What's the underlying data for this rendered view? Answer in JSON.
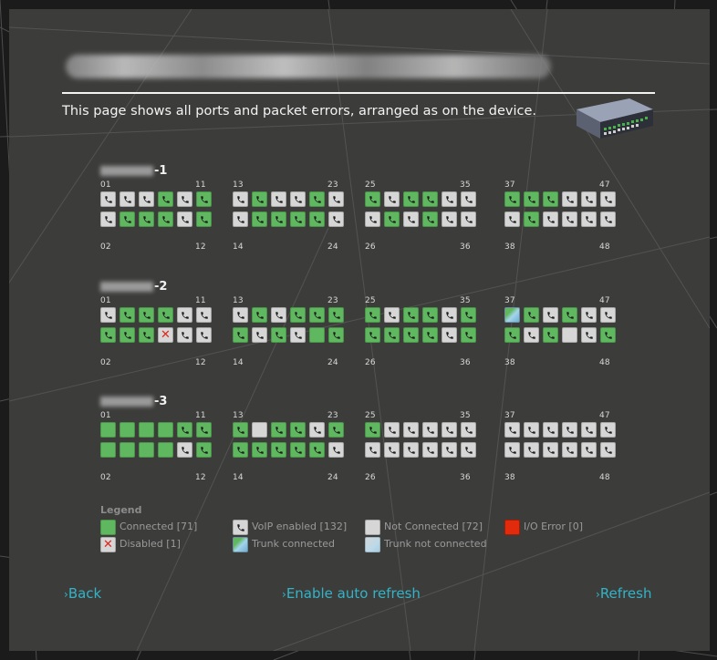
{
  "page": {
    "intro": "This page shows all ports and packet errors, arranged as on the device."
  },
  "colors": {
    "panel_background": "#3c3c3b",
    "connected": "#5fb85f",
    "not_connected": "#d6d6d6",
    "io_error": "#e12b0c",
    "link": "#34b3c7"
  },
  "device_icon": "network-switch-image",
  "units": [
    {
      "title_suffix": "-1",
      "groups": [
        {
          "top_first": "01",
          "top_last": "11",
          "bottom_first": "02",
          "bottom_last": "12",
          "top": [
            "N",
            "N",
            "N",
            "C",
            "N",
            "C"
          ],
          "bottom": [
            "N",
            "C",
            "C",
            "C",
            "N",
            "C"
          ]
        },
        {
          "top_first": "13",
          "top_last": "23",
          "bottom_first": "14",
          "bottom_last": "24",
          "top": [
            "N",
            "C",
            "N",
            "N",
            "C",
            "N"
          ],
          "bottom": [
            "N",
            "C",
            "C",
            "C",
            "C",
            "N"
          ]
        },
        {
          "top_first": "25",
          "top_last": "35",
          "bottom_first": "26",
          "bottom_last": "36",
          "top": [
            "C",
            "N",
            "C",
            "C",
            "N",
            "N"
          ],
          "bottom": [
            "N",
            "C",
            "N",
            "C",
            "N",
            "N"
          ]
        },
        {
          "top_first": "37",
          "top_last": "47",
          "bottom_first": "38",
          "bottom_last": "48",
          "top": [
            "C",
            "C",
            "C",
            "N",
            "N",
            "N"
          ],
          "bottom": [
            "N",
            "C",
            "N",
            "N",
            "N",
            "N"
          ]
        }
      ]
    },
    {
      "title_suffix": "-2",
      "groups": [
        {
          "top_first": "01",
          "top_last": "11",
          "bottom_first": "02",
          "bottom_last": "12",
          "top": [
            "N",
            "C",
            "C",
            "C",
            "N",
            "N"
          ],
          "bottom": [
            "C",
            "C",
            "C",
            "D",
            "N",
            "N"
          ]
        },
        {
          "top_first": "13",
          "top_last": "23",
          "bottom_first": "14",
          "bottom_last": "24",
          "top": [
            "N",
            "C",
            "N",
            "C",
            "C",
            "C"
          ],
          "bottom": [
            "C",
            "N",
            "C",
            "N",
            "G",
            "C"
          ]
        },
        {
          "top_first": "25",
          "top_last": "35",
          "bottom_first": "26",
          "bottom_last": "36",
          "top": [
            "C",
            "N",
            "C",
            "C",
            "N",
            "C"
          ],
          "bottom": [
            "C",
            "C",
            "C",
            "C",
            "N",
            "C"
          ]
        },
        {
          "top_first": "37",
          "top_last": "47",
          "bottom_first": "38",
          "bottom_last": "48",
          "top": [
            "T",
            "C",
            "N",
            "C",
            "N",
            "N"
          ],
          "bottom": [
            "C",
            "N",
            "C",
            "X",
            "N",
            "C"
          ]
        }
      ]
    },
    {
      "title_suffix": "-3",
      "groups": [
        {
          "top_first": "01",
          "top_last": "11",
          "bottom_first": "02",
          "bottom_last": "12",
          "top": [
            "G",
            "G",
            "G",
            "G",
            "C",
            "C"
          ],
          "bottom": [
            "G",
            "G",
            "G",
            "G",
            "N",
            "C"
          ]
        },
        {
          "top_first": "13",
          "top_last": "23",
          "bottom_first": "14",
          "bottom_last": "24",
          "top": [
            "C",
            "X",
            "C",
            "C",
            "N",
            "C"
          ],
          "bottom": [
            "C",
            "C",
            "C",
            "C",
            "C",
            "N"
          ]
        },
        {
          "top_first": "25",
          "top_last": "35",
          "bottom_first": "26",
          "bottom_last": "36",
          "top": [
            "C",
            "N",
            "N",
            "N",
            "N",
            "N"
          ],
          "bottom": [
            "N",
            "N",
            "N",
            "N",
            "N",
            "N"
          ]
        },
        {
          "top_first": "37",
          "top_last": "47",
          "bottom_first": "38",
          "bottom_last": "48",
          "top": [
            "N",
            "N",
            "N",
            "N",
            "N",
            "N"
          ],
          "bottom": [
            "N",
            "N",
            "N",
            "N",
            "N",
            "N"
          ]
        }
      ]
    }
  ],
  "legend": {
    "title": "Legend",
    "connected": "Connected [71]",
    "voip": "VoIP enabled [132]",
    "not_connected": "Not Connected [72]",
    "io_error": "I/O Error [0]",
    "disabled": "Disabled [1]",
    "trunk_connected": "Trunk connected",
    "trunk_not_connected": "Trunk not connected"
  },
  "nav": {
    "back": "Back",
    "auto_refresh": "Enable auto refresh",
    "refresh": "Refresh",
    "chevron": "›"
  }
}
